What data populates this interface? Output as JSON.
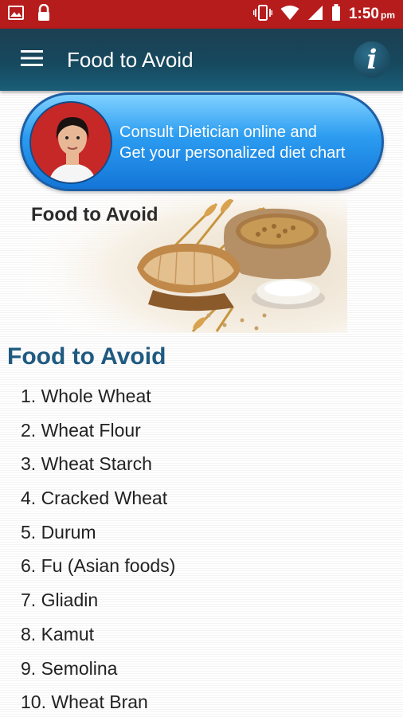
{
  "status_bar": {
    "time": "1:50",
    "time_suffix": "pm"
  },
  "app_bar": {
    "title": "Food to Avoid",
    "info_label": "i"
  },
  "consult_banner": {
    "line1": "Consult Dietician online and",
    "line2": "Get your personalized diet chart"
  },
  "hero": {
    "title": "Food to Avoid"
  },
  "section": {
    "heading": "Food to Avoid",
    "items": [
      "1. Whole Wheat",
      "2. Wheat Flour",
      "3. Wheat Starch",
      "4. Cracked Wheat",
      "5. Durum",
      "6. Fu (Asian foods)",
      "7. Gliadin",
      "8. Kamut",
      "9. Semolina",
      "10. Wheat Bran"
    ]
  },
  "colors": {
    "status_bar": "#b71c1c",
    "app_bar": "#16485e",
    "heading": "#1f5a80",
    "banner": "#2b9cf0"
  }
}
